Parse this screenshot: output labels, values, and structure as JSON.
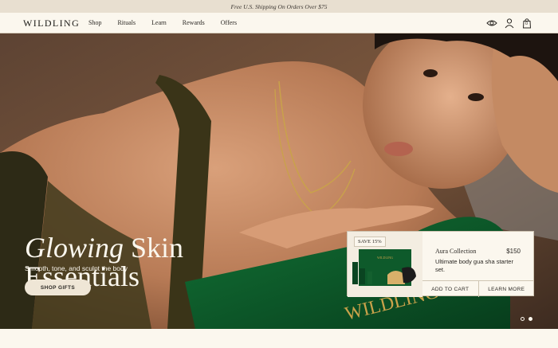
{
  "announcement": "Free U.S. Shipping On Orders Over $75",
  "brand": "WILDLING",
  "nav": {
    "items": [
      "Shop",
      "Rituals",
      "Learn",
      "Rewards",
      "Offers"
    ],
    "icons": [
      "eye-icon",
      "account-icon",
      "cart-icon"
    ],
    "cart_count": "0"
  },
  "hero": {
    "title_italic": "Glowing",
    "title_rest": " Skin",
    "title_line2": "Essentials",
    "subtitle": "Smooth, tone, and sculpt the body",
    "cta": "SHOP GIFTS",
    "box_brand": "WILDLING"
  },
  "product_card": {
    "badge": "SAVE 15%",
    "name": "Aura Collection",
    "price": "$150",
    "description": "Ultimate body gua sha starter set.",
    "add_to_cart": "ADD TO CART",
    "learn_more": "LEARN MORE",
    "mini_brand": "WILDLING"
  },
  "carousel": {
    "slides": 2,
    "active_index": 1
  },
  "colors": {
    "cream": "#fbf7ee",
    "brand_green": "#0f5a2c",
    "gold": "#c9a24a"
  }
}
